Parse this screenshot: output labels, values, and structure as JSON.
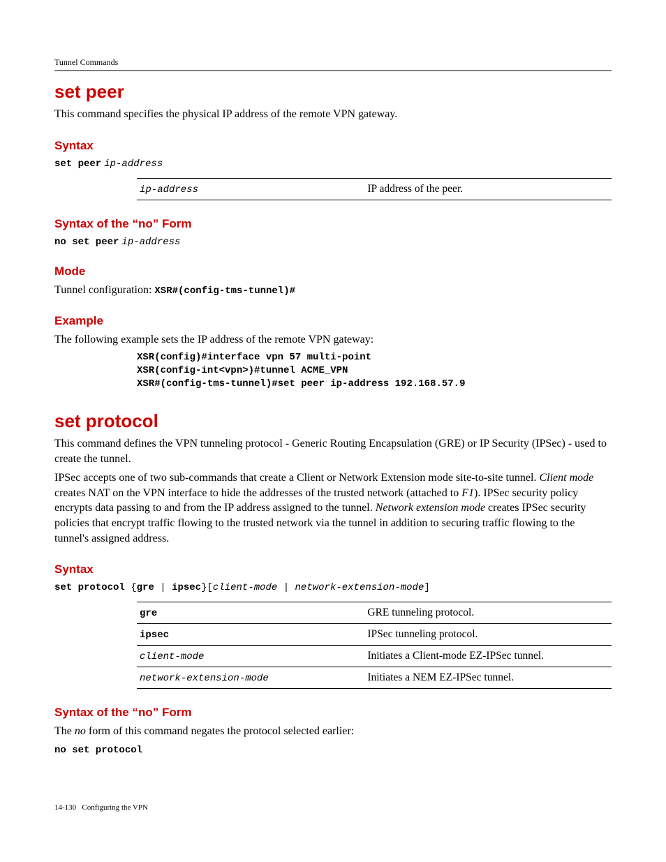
{
  "header": {
    "running": "Tunnel Commands"
  },
  "section1": {
    "title": "set peer",
    "intro": "This command specifies the physical IP address of the remote VPN gateway.",
    "syntax_h": "Syntax",
    "syntax_cmd": "set peer",
    "syntax_arg": "ip-address",
    "param_table": {
      "r1c1": "ip-address",
      "r1c2": "IP address of the peer."
    },
    "noform_h": "Syntax of the “no” Form",
    "noform_cmd": "no set peer",
    "noform_arg": "ip-address",
    "mode_h": "Mode",
    "mode_label": "Tunnel configuration: ",
    "mode_code": "XSR#(config-tms-tunnel)#",
    "example_h": "Example",
    "example_intro": "The following example sets the IP address of the remote VPN gateway:",
    "example_lines": {
      "l1": "XSR(config)#interface vpn 57 multi-point",
      "l2": "XSR(config-int<vpn>)#tunnel ACME_VPN",
      "l3": "XSR#(config-tms-tunnel)#set peer ip-address 192.168.57.9"
    }
  },
  "section2": {
    "title": "set protocol",
    "p1": "This command defines the VPN tunneling protocol - Generic Routing Encapsulation (GRE) or IP Security (IPSec) - used to create the tunnel.",
    "p2_a": "IPSec accepts one of two sub-commands that create a Client or Network Extension mode site-to-site tunnel. ",
    "p2_i1": "Client mode",
    "p2_b": " creates NAT on the VPN interface to hide the addresses of the trusted network (attached to ",
    "p2_i2": "F1",
    "p2_c": "). IPSec security policy encrypts data passing to and from the IP address assigned to the tunnel. ",
    "p2_i3": "Network extension mode",
    "p2_d": " creates IPSec security policies that encrypt traffic flowing to the trusted network via the tunnel in addition to securing traffic flowing to the tunnel's assigned address.",
    "syntax_h": "Syntax",
    "syntax_parts": {
      "a": "set protocol",
      "b": " {",
      "c": "gre",
      "d": " | ",
      "e": "ipsec",
      "f": "}[",
      "g": "client-mode | network-extension-mode",
      "h": "]"
    },
    "param_table": {
      "r1c1": "gre",
      "r1c2": "GRE tunneling protocol.",
      "r2c1": "ipsec",
      "r2c2": "IPSec tunneling protocol.",
      "r3c1": "client-mode",
      "r3c2": "Initiates a Client-mode EZ-IPSec tunnel.",
      "r4c1": "network-extension-mode",
      "r4c2": "Initiates a NEM EZ-IPSec tunnel."
    },
    "noform_h": "Syntax of the “no” Form",
    "noform_intro_a": "The ",
    "noform_intro_i": "no",
    "noform_intro_b": " form of this command negates the protocol selected earlier:",
    "noform_cmd": "no set protocol"
  },
  "footer": {
    "pageno": "14-130",
    "chapter": "Configuring the VPN"
  }
}
